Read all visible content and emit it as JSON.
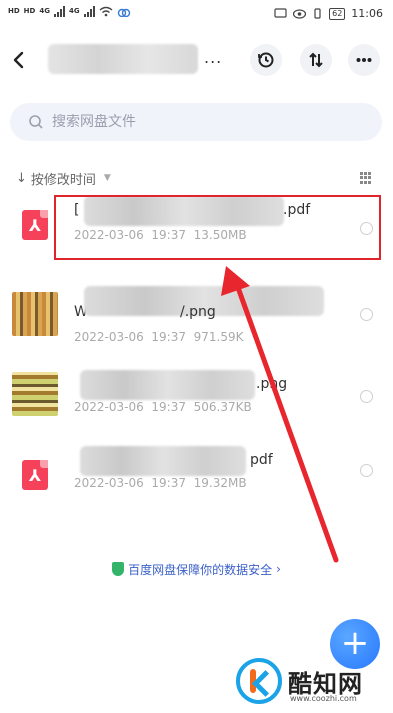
{
  "status_bar": {
    "left_tags": [
      "HD",
      "HD",
      "4G",
      "4G"
    ],
    "battery": "62",
    "time": "11:06"
  },
  "header": {
    "title_suffix": "...",
    "back_icon": "chevron-left-icon",
    "history_icon": "clock-history-icon",
    "sort_icon": "sort-arrows-icon",
    "more_icon": "more-dots-icon"
  },
  "search": {
    "placeholder": "搜索网盘文件",
    "icon": "search-icon"
  },
  "sort": {
    "label": "按修改时间",
    "view_icon": "grid-view-icon"
  },
  "files": [
    {
      "name_visible": "[",
      "ext": ".pdf",
      "date": "2022-03-06",
      "time": "19:37",
      "size": "13.50MB",
      "type": "pdf",
      "highlighted": true
    },
    {
      "name_visible": "W",
      "ext": "/.png",
      "date": "2022-03-06",
      "time": "19:37",
      "size": "971.59K",
      "type": "image"
    },
    {
      "name_visible": "",
      "ext": ".png",
      "date": "2022-03-06",
      "time": "19:37",
      "size": "506.37KB",
      "type": "image"
    },
    {
      "name_visible": "",
      "ext": "pdf",
      "date": "2022-03-06",
      "time": "19:37",
      "size": "19.32MB",
      "type": "pdf"
    }
  ],
  "security": {
    "text": "百度网盘保障你的数据安全",
    "chevron": "›"
  },
  "fab": {
    "label": "+"
  },
  "watermark": {
    "brand": "酷知网",
    "url": "www.coozhi.com"
  },
  "colors": {
    "accent": "#2778ff",
    "highlight": "#e0242c",
    "pdf": "#f5425a",
    "security_text": "#3a5fc8"
  }
}
